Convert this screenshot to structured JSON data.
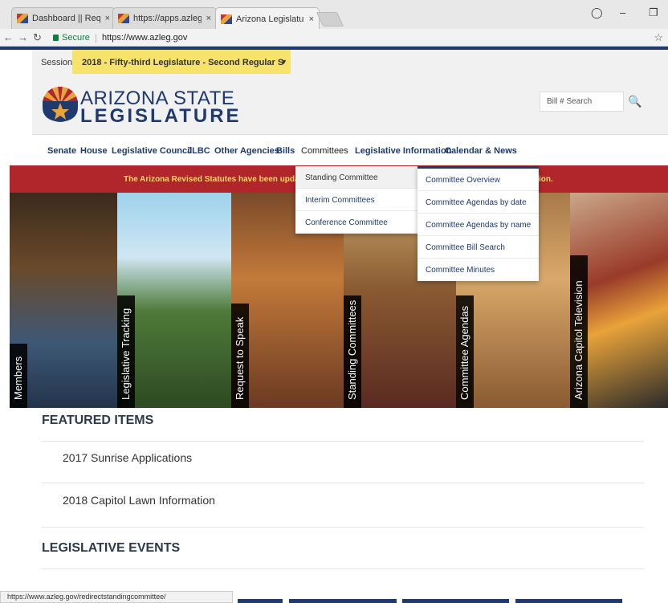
{
  "browser": {
    "tabs": [
      {
        "label": "Dashboard || Request to",
        "close": "×"
      },
      {
        "label": "https://apps.azleg.gov/R",
        "close": "×"
      },
      {
        "label": "Arizona Legislature",
        "close": "×"
      }
    ],
    "secure_label": "Secure",
    "url": "https://www.azleg.gov",
    "status_url": "https://www.azleg.gov/redirectstandingcommittee/"
  },
  "session": {
    "label": "Session:",
    "selected": "2018 - Fifty-third Legislature - Second Regular S"
  },
  "header": {
    "logo_top": "ARIZONA STATE",
    "logo_bottom": "LEGISLATURE",
    "search_placeholder": "Bill # Search",
    "brand_colors": {
      "navy": "#1e3a6e",
      "red": "#b0262b",
      "gold": "#e8a33a"
    }
  },
  "nav": {
    "items": [
      "Senate",
      "House",
      "Legislative Council",
      "JLBC",
      "Other Agencies",
      "Bills",
      "Committees",
      "Legislative Information",
      "Calendar & News"
    ]
  },
  "alert": {
    "text": "The Arizona Revised Statutes have been updated",
    "tail": "ion."
  },
  "committees_menu": {
    "items": [
      "Standing Committee",
      "Interim Committees",
      "Conference Committee"
    ],
    "submenu": [
      "Committee Overview",
      "Committee Agendas by date",
      "Committee Agendas by name",
      "Committee Bill Search",
      "Committee Minutes"
    ]
  },
  "hero": {
    "panels": [
      "Members",
      "Legislative Tracking",
      "Request to Speak",
      "Standing Committees",
      "Committee Agendas",
      "Arizona Capitol Television"
    ]
  },
  "featured": {
    "title": "FEATURED ITEMS",
    "items": [
      "2017 Sunrise Applications",
      "2018 Capitol Lawn Information"
    ]
  },
  "events": {
    "title": "LEGISLATIVE EVENTS"
  }
}
